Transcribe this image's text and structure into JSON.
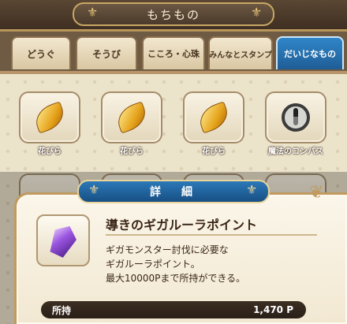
{
  "header": {
    "title": "もちもの"
  },
  "tabs": [
    {
      "label": "どうぐ",
      "active": false
    },
    {
      "label": "そうび",
      "active": false
    },
    {
      "label": "こころ・心珠",
      "active": false
    },
    {
      "label": "みんなとスタンプ",
      "active": false
    },
    {
      "label": "だいじなもの",
      "active": true
    }
  ],
  "items": [
    {
      "label": "花びら",
      "icon": "petal-icon"
    },
    {
      "label": "花びら",
      "icon": "petal-icon"
    },
    {
      "label": "花びら",
      "icon": "petal-icon"
    },
    {
      "label": "魔法のコンパス",
      "icon": "compass-icon"
    }
  ],
  "detail": {
    "title": "詳　細",
    "item_name": "導きのギガルーラポイント",
    "icon": "crystal-icon",
    "description": [
      "ギガモンスター討伐に必要な",
      "ギガルーラポイント。",
      "最大10000Pまで所持ができる。"
    ],
    "possession_label": "所持",
    "possession_value": "1,470 P"
  },
  "colors": {
    "active_tab": "#2f86c8",
    "panel_border": "#c09a5e",
    "header_bg": "#4b3a2b"
  }
}
